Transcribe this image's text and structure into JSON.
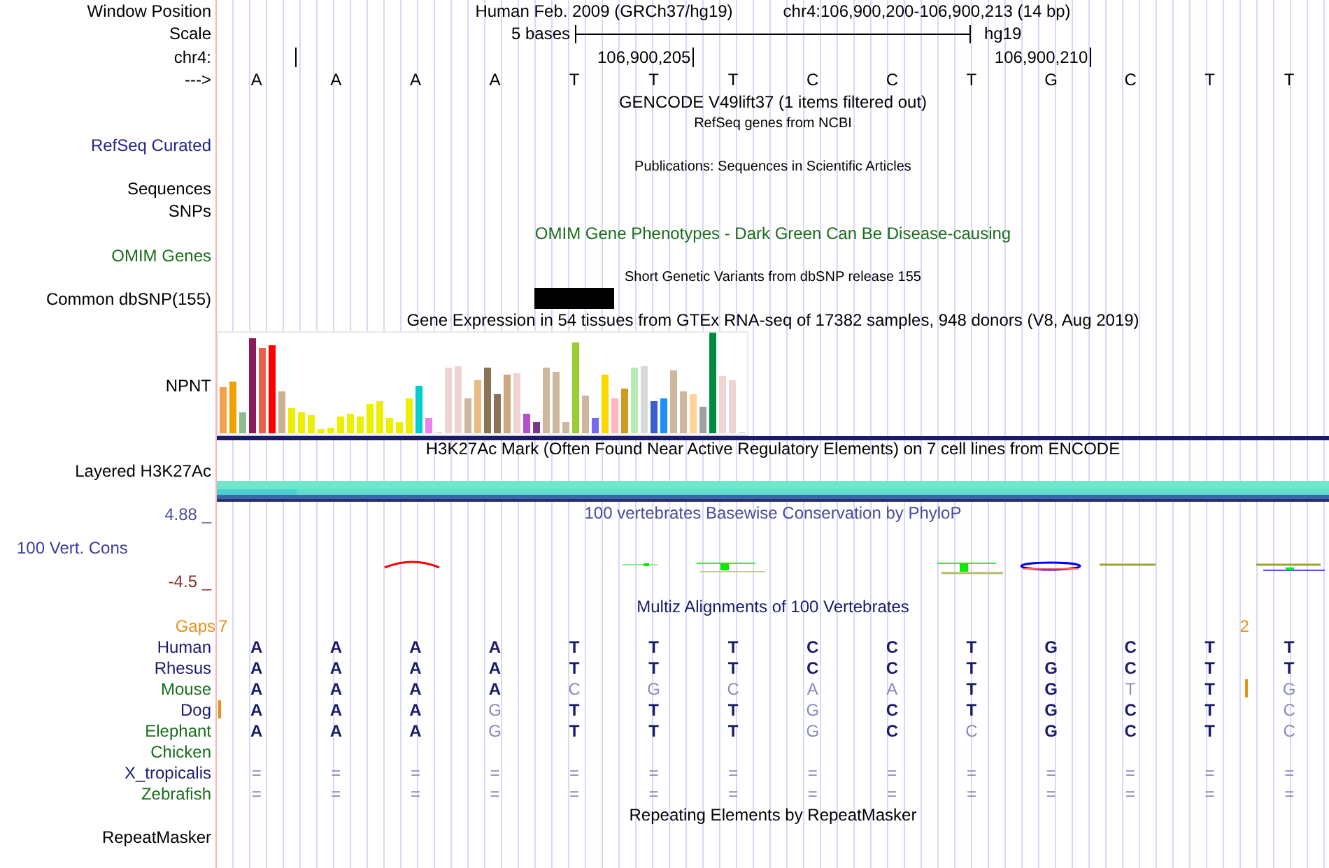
{
  "rows": [
    {
      "kind": "position",
      "label": "Window Position",
      "assembly": "Human Feb. 2009 (GRCh37/hg19)",
      "position": "chr4:106,900,200-106,900,213 (14 bp)"
    },
    {
      "kind": "scale",
      "label": "Scale",
      "text": "5 bases",
      "db": "hg19"
    },
    {
      "kind": "ruler",
      "label": "chr4:",
      "tick_labels": [
        "106,900,205",
        "106,900,210"
      ]
    },
    {
      "kind": "bases",
      "label": "--->",
      "bases": [
        "A",
        "A",
        "A",
        "A",
        "T",
        "T",
        "T",
        "C",
        "C",
        "T",
        "G",
        "C",
        "T",
        "T"
      ]
    },
    {
      "kind": "title",
      "text": "GENCODE V49lift37 (1 items filtered out)",
      "color": "#000000"
    },
    {
      "kind": "note",
      "text": "RefSeq genes from NCBI"
    },
    {
      "kind": "track",
      "label": "RefSeq Curated",
      "color": "#24248c"
    },
    {
      "kind": "note",
      "text": "Publications: Sequences in Scientific Articles"
    },
    {
      "kind": "track",
      "label": "Sequences",
      "color": "#000000"
    },
    {
      "kind": "track",
      "label": "SNPs",
      "color": "#000000"
    },
    {
      "kind": "title",
      "text": "OMIM Gene Phenotypes - Dark Green Can Be Disease-causing",
      "color": "#1a6e1a"
    },
    {
      "kind": "track",
      "label": "OMIM Genes",
      "color": "#1a6e1a"
    },
    {
      "kind": "note",
      "text": "Short Genetic Variants from dbSNP release 155"
    },
    {
      "kind": "snp",
      "label": "Common dbSNP(155)",
      "covered": [
        false,
        false,
        false,
        false,
        true,
        false,
        false,
        false,
        false,
        false,
        false,
        false,
        false,
        false
      ]
    },
    {
      "kind": "title",
      "text": "Gene Expression in 54 tissues from GTEx RNA-seq of 17382 samples, 948 donors (V8, Aug 2019)",
      "color": "#000000"
    },
    {
      "kind": "expression",
      "label": "NPNT"
    },
    {
      "kind": "title",
      "text": "H3K27Ac Mark (Often Found Near Active Regulatory Elements) on 7 cell lines from ENCODE",
      "color": "#000000"
    },
    {
      "kind": "layered",
      "label": "Layered H3K27Ac"
    },
    {
      "kind": "wiggle",
      "label": "100 Vert. Cons",
      "max": "4.88 _",
      "min": "-4.5 _",
      "title": "100 vertebrates Basewise Conservation by PhyloP"
    },
    {
      "kind": "title",
      "text": "Multiz Alignments of 100 Vertebrates",
      "color": "#1a1a6e"
    },
    {
      "kind": "gaps",
      "label": "Gaps",
      "columns": [
        {
          "count": "7"
        },
        {},
        {},
        {},
        {},
        {},
        {},
        {},
        {},
        {},
        {},
        {},
        {},
        {
          "count": "2"
        }
      ]
    },
    {
      "kind": "species",
      "label": "Human",
      "color": "#1a1a6e",
      "bases": [
        "A",
        "A",
        "A",
        "A",
        "T",
        "T",
        "T",
        "C",
        "C",
        "T",
        "G",
        "C",
        "T",
        "T"
      ],
      "faint": [
        false,
        false,
        false,
        false,
        false,
        false,
        false,
        false,
        false,
        false,
        false,
        false,
        false,
        false
      ],
      "insert": [
        false,
        false,
        false,
        false,
        false,
        false,
        false,
        false,
        false,
        false,
        false,
        false,
        false,
        false
      ]
    },
    {
      "kind": "species",
      "label": "Rhesus",
      "color": "#1a1a6e",
      "bases": [
        "A",
        "A",
        "A",
        "A",
        "T",
        "T",
        "T",
        "C",
        "C",
        "T",
        "G",
        "C",
        "T",
        "T"
      ],
      "faint": [
        false,
        false,
        false,
        false,
        false,
        false,
        false,
        false,
        false,
        false,
        false,
        false,
        false,
        false
      ],
      "insert": [
        false,
        false,
        false,
        false,
        false,
        false,
        false,
        false,
        false,
        false,
        false,
        false,
        false,
        false
      ]
    },
    {
      "kind": "species",
      "label": "Mouse",
      "color": "#1a6e1a",
      "bases": [
        "A",
        "A",
        "A",
        "A",
        "C",
        "G",
        "C",
        "A",
        "A",
        "T",
        "G",
        "T",
        "T",
        "G"
      ],
      "faint": [
        false,
        false,
        false,
        false,
        true,
        true,
        true,
        true,
        true,
        false,
        false,
        true,
        false,
        true
      ],
      "insert": [
        false,
        false,
        false,
        false,
        false,
        false,
        false,
        false,
        false,
        false,
        false,
        false,
        false,
        true
      ]
    },
    {
      "kind": "species",
      "label": "Dog",
      "color": "#1a1a6e",
      "bases": [
        "A",
        "A",
        "A",
        "G",
        "T",
        "T",
        "T",
        "G",
        "C",
        "T",
        "G",
        "C",
        "T",
        "C"
      ],
      "faint": [
        false,
        false,
        false,
        true,
        false,
        false,
        false,
        true,
        false,
        false,
        false,
        false,
        false,
        true
      ],
      "insert": [
        true,
        false,
        false,
        false,
        false,
        false,
        false,
        false,
        false,
        false,
        false,
        false,
        false,
        false
      ]
    },
    {
      "kind": "species",
      "label": "Elephant",
      "color": "#1a6e1a",
      "bases": [
        "A",
        "A",
        "A",
        "G",
        "T",
        "T",
        "T",
        "G",
        "C",
        "C",
        "G",
        "C",
        "T",
        "C"
      ],
      "faint": [
        false,
        false,
        false,
        true,
        false,
        false,
        false,
        true,
        false,
        true,
        false,
        false,
        false,
        true
      ],
      "insert": [
        false,
        false,
        false,
        false,
        false,
        false,
        false,
        false,
        false,
        false,
        false,
        false,
        false,
        false
      ]
    },
    {
      "kind": "species",
      "label": "Chicken",
      "color": "#1a6e1a"
    },
    {
      "kind": "species",
      "label": "X_tropicalis",
      "color": "#1a1a6e",
      "bases": [
        "=",
        "=",
        "=",
        "=",
        "=",
        "=",
        "=",
        "=",
        "=",
        "=",
        "=",
        "=",
        "=",
        "="
      ],
      "faint": [
        true,
        true,
        true,
        true,
        true,
        true,
        true,
        true,
        true,
        true,
        true,
        true,
        true,
        true
      ],
      "insert": [
        false,
        false,
        false,
        false,
        false,
        false,
        false,
        false,
        false,
        false,
        false,
        false,
        false,
        false
      ]
    },
    {
      "kind": "species",
      "label": "Zebrafish",
      "color": "#1a6e1a",
      "bases": [
        "=",
        "=",
        "=",
        "=",
        "=",
        "=",
        "=",
        "=",
        "=",
        "=",
        "=",
        "=",
        "=",
        "="
      ],
      "faint": [
        true,
        true,
        true,
        true,
        true,
        true,
        true,
        true,
        true,
        true,
        true,
        true,
        true,
        true
      ],
      "insert": [
        false,
        false,
        false,
        false,
        false,
        false,
        false,
        false,
        false,
        false,
        false,
        false,
        false,
        false
      ]
    },
    {
      "kind": "title",
      "text": "Repeating Elements by RepeatMasker",
      "color": "#000000"
    },
    {
      "kind": "track",
      "label": "RepeatMasker",
      "color": "#000000"
    }
  ]
}
